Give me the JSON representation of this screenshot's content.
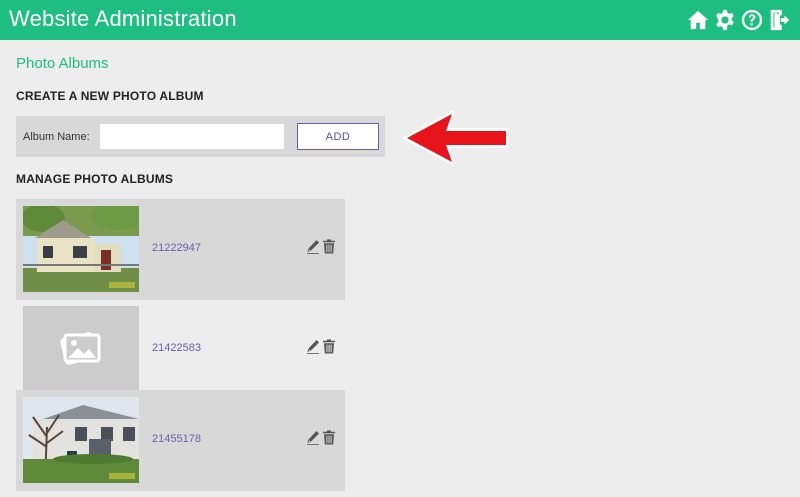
{
  "header": {
    "title": "Website Administration",
    "icons": [
      "home-icon",
      "gear-icon",
      "help-icon",
      "logout-icon"
    ],
    "background_color": "#1ebd82"
  },
  "breadcrumb": "Photo Albums",
  "create_section": {
    "heading": "CREATE A NEW PHOTO ALBUM",
    "album_name_label": "Album Name:",
    "album_name_value": "",
    "add_label": "ADD",
    "annotation": "red-arrow-pointing-left"
  },
  "manage_section": {
    "heading": "MANAGE PHOTO ALBUMS",
    "albums": [
      {
        "id": "21222947",
        "thumbnail": "house-photo",
        "thumbnail_date": "06/22/2012",
        "actions": [
          "edit-icon",
          "trash-icon"
        ]
      },
      {
        "id": "21422583",
        "thumbnail": "photo-placeholder-icon",
        "actions": [
          "edit-icon",
          "trash-icon"
        ]
      },
      {
        "id": "21455178",
        "thumbnail": "house-photo",
        "thumbnail_date": "12/21/2014",
        "actions": [
          "edit-icon",
          "trash-icon"
        ]
      }
    ]
  },
  "colors": {
    "accent": "#1ebd82",
    "link": "#6b5fa8",
    "arrow": "#e8141b"
  }
}
